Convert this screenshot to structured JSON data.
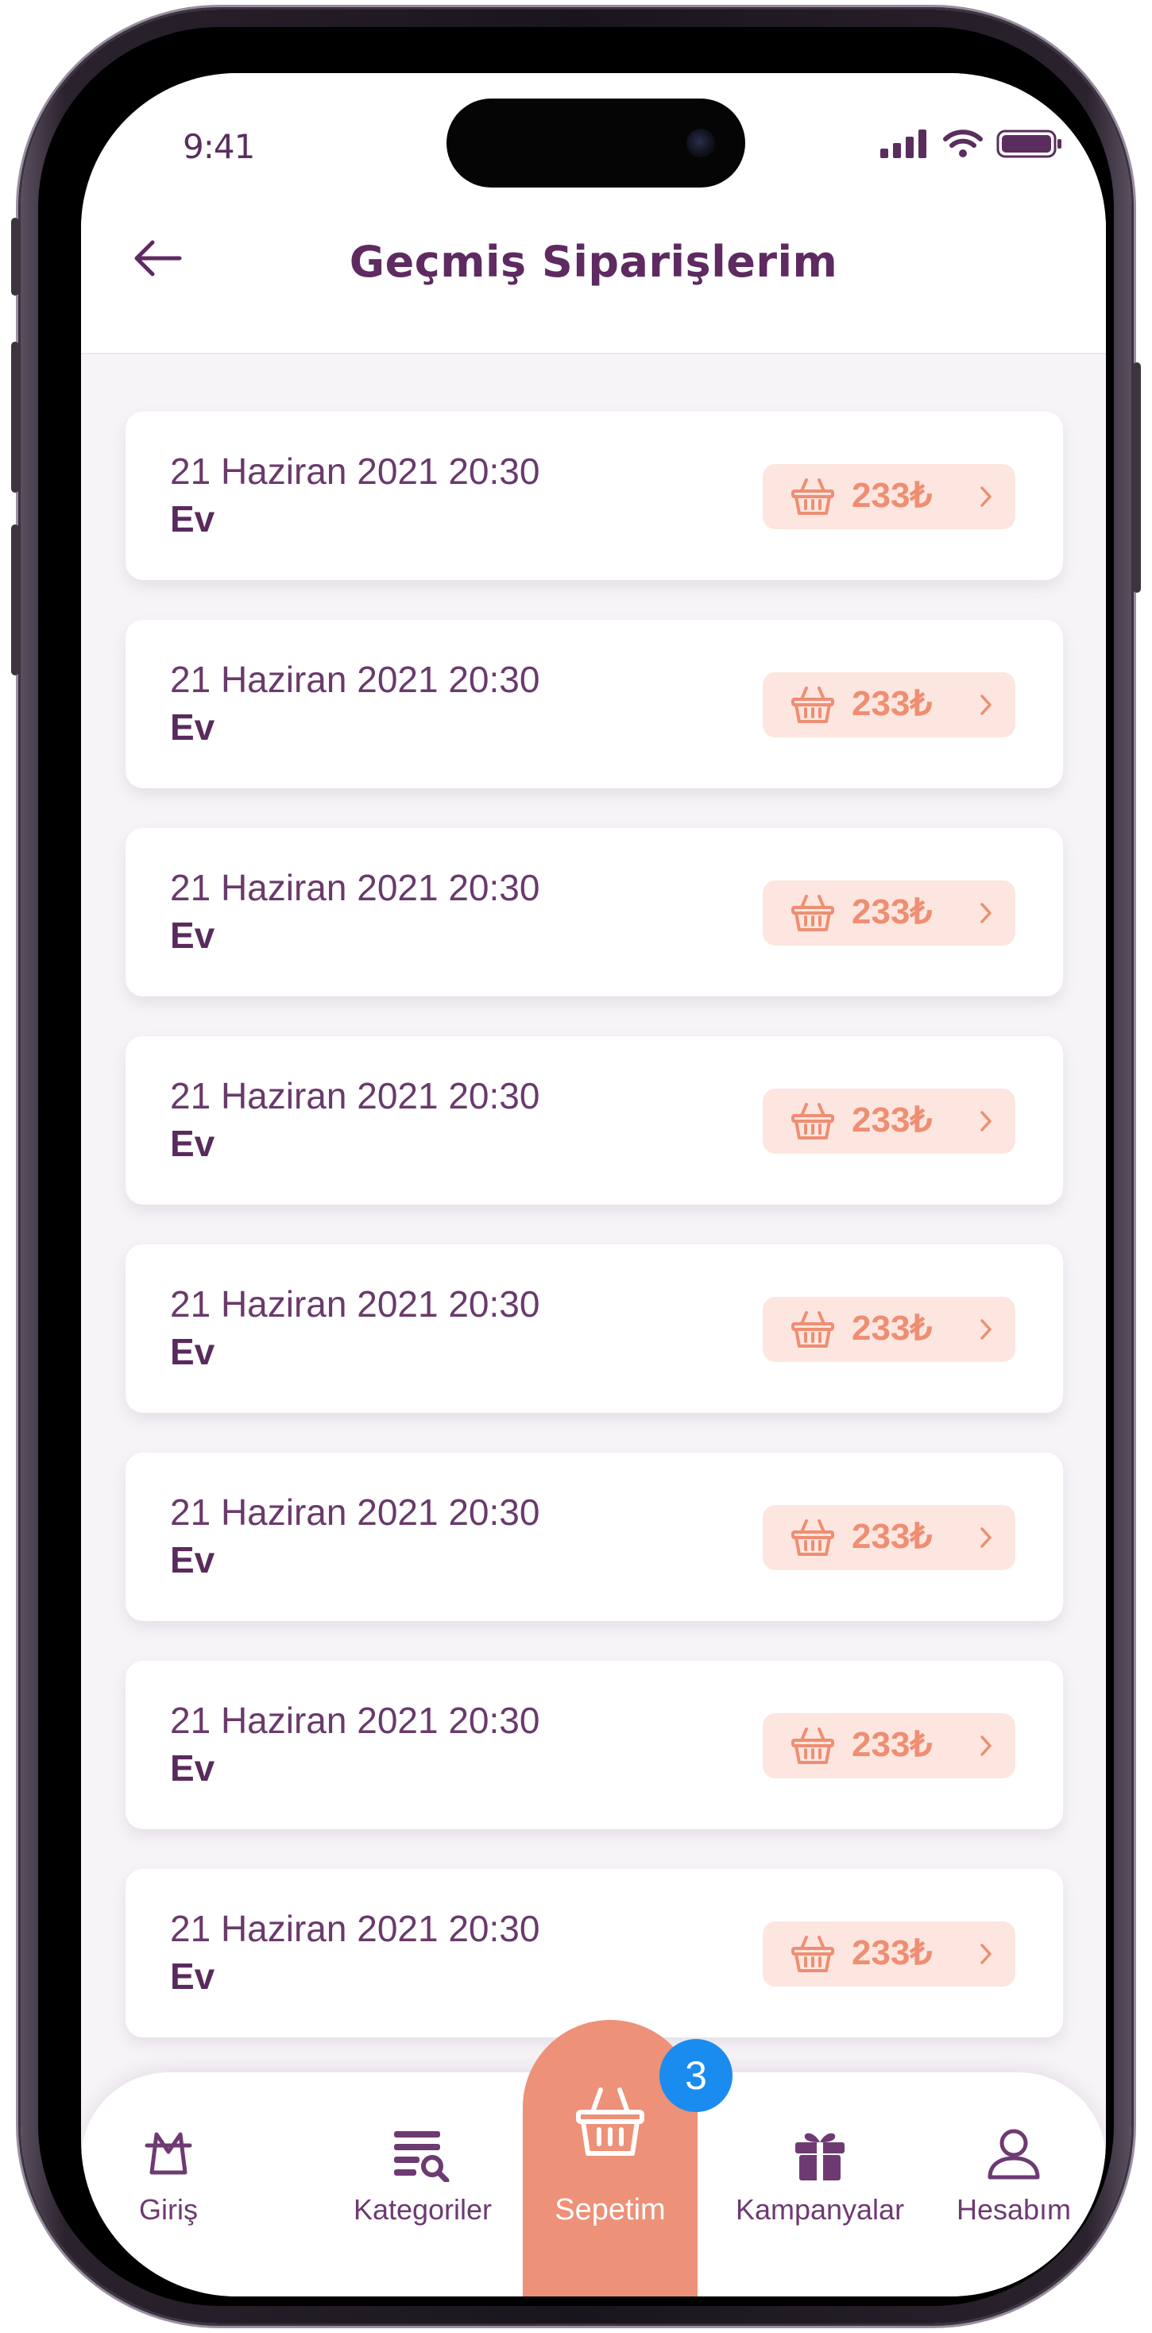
{
  "status_bar": {
    "time": "9:41"
  },
  "header": {
    "title": "Geçmiş Siparişlerim"
  },
  "orders": [
    {
      "date": "21 Haziran 2021 20:30",
      "place": "Ev",
      "amount": "233₺"
    },
    {
      "date": "21 Haziran 2021 20:30",
      "place": "Ev",
      "amount": "233₺"
    },
    {
      "date": "21 Haziran 2021 20:30",
      "place": "Ev",
      "amount": "233₺"
    },
    {
      "date": "21 Haziran 2021 20:30",
      "place": "Ev",
      "amount": "233₺"
    },
    {
      "date": "21 Haziran 2021 20:30",
      "place": "Ev",
      "amount": "233₺"
    },
    {
      "date": "21 Haziran 2021 20:30",
      "place": "Ev",
      "amount": "233₺"
    },
    {
      "date": "21 Haziran 2021 20:30",
      "place": "Ev",
      "amount": "233₺"
    },
    {
      "date": "21 Haziran 2021 20:30",
      "place": "Ev",
      "amount": "233₺"
    }
  ],
  "tabbar": {
    "items": [
      {
        "label": "Giriş",
        "icon": "home-basket-icon"
      },
      {
        "label": "Kategoriler",
        "icon": "category-search-icon"
      },
      {
        "label": "Sepetim",
        "icon": "basket-icon",
        "active": true
      },
      {
        "label": "Kampanyalar",
        "icon": "gift-icon"
      },
      {
        "label": "Hesabım",
        "icon": "user-icon"
      }
    ],
    "cart_badge": "3"
  },
  "colors": {
    "primary": "#5e2a61",
    "accent": "#ed9178",
    "pill_bg": "#fde6df",
    "badge": "#1a8cf0"
  }
}
